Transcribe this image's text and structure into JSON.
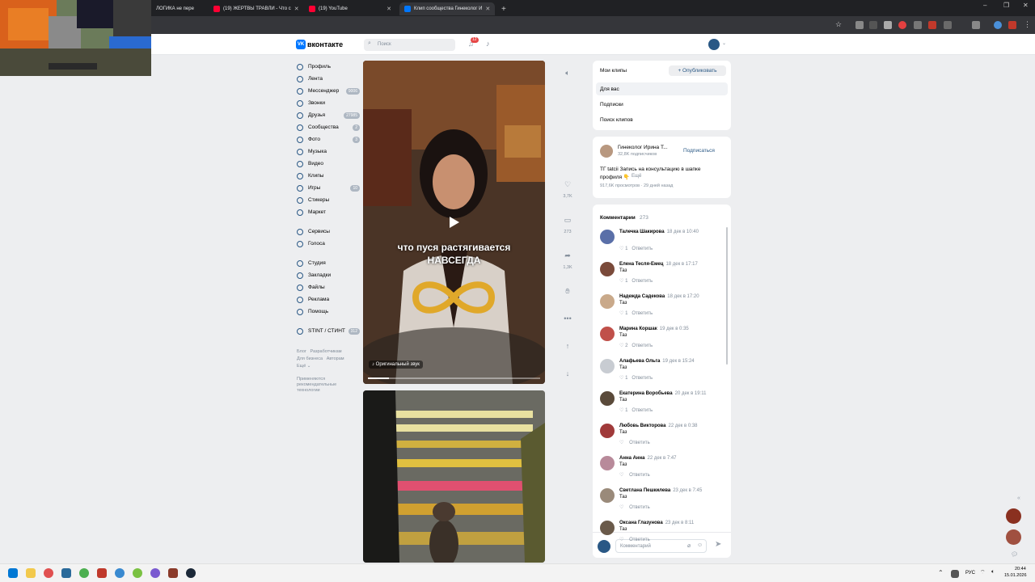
{
  "browser": {
    "tabs": [
      {
        "title": "ЛОГИКА не пере"
      },
      {
        "title": "(19) ЖЕРТВЫ ТРАВЛИ - Что с"
      },
      {
        "title": "(19) YouTube"
      },
      {
        "title": "Клип сообщества Гинеколог И"
      }
    ],
    "new_tab": "+",
    "window_controls": {
      "min": "–",
      "max": "❐",
      "close": "✕"
    }
  },
  "vk": {
    "logo_text": "вконтакте",
    "search_placeholder": "Поиск",
    "notif_count": "12"
  },
  "nav": {
    "items": [
      {
        "label": "Профиль",
        "badge": ""
      },
      {
        "label": "Лента",
        "badge": ""
      },
      {
        "label": "Мессенджер",
        "badge": "9006"
      },
      {
        "label": "Звонки",
        "badge": ""
      },
      {
        "label": "Друзья",
        "badge": "27985"
      },
      {
        "label": "Сообщества",
        "badge": "2"
      },
      {
        "label": "Фото",
        "badge": "3"
      },
      {
        "label": "Музыка",
        "badge": ""
      },
      {
        "label": "Видео",
        "badge": ""
      },
      {
        "label": "Клипы",
        "badge": ""
      },
      {
        "label": "Игры",
        "badge": "10"
      },
      {
        "label": "Стикеры",
        "badge": ""
      },
      {
        "label": "Маркет",
        "badge": ""
      }
    ],
    "items2": [
      {
        "label": "Сервисы",
        "badge": ""
      },
      {
        "label": "Голоса",
        "badge": ""
      }
    ],
    "items3": [
      {
        "label": "Студия",
        "badge": ""
      },
      {
        "label": "Закладки",
        "badge": ""
      },
      {
        "label": "Файлы",
        "badge": ""
      },
      {
        "label": "Реклама",
        "badge": ""
      },
      {
        "label": "Помощь",
        "badge": ""
      }
    ],
    "items4": [
      {
        "label": "STINT / СТИНТ",
        "badge": "312"
      }
    ],
    "footer": {
      "blog": "Блог",
      "devs": "Разработчикам",
      "business": "Для бизнеса",
      "authors": "Авторам",
      "more": "Ещё ⌄",
      "rec": "Применяются рекомендательные технологии"
    }
  },
  "video": {
    "caption_line1": "что пуся растягивается",
    "caption_line2": "НАВСЕГДА",
    "sound_label": "♪ Оригинальный звук",
    "progress": 0.12
  },
  "actions": {
    "likes": "3,7K",
    "comments": "273",
    "shares": "1,3K"
  },
  "clips_menu": {
    "title": "Мои клипы",
    "publish": "Опубликовать",
    "items": [
      "Для вас",
      "Подписки",
      "Поиск клипов"
    ]
  },
  "author": {
    "name": "Гинеколог Ирина Т...",
    "subs": "32,8K подписчиков",
    "subscribe": "Подписаться",
    "desc_line1": "TГ tatcii Запись на консультацию в шапке",
    "desc_line2": "профиля 👇",
    "more": "Ещё",
    "stats": "917,6K просмотров · 29 дней назад"
  },
  "comments": {
    "title": "Комментарии",
    "count": "273",
    "placeholder": "Комментарий",
    "list": [
      {
        "name": "Талечка Шакирова",
        "date": "18 дек в 10:40",
        "text": "",
        "likes": "1",
        "color": "#5a6fa8"
      },
      {
        "name": "Елена Тесля-Емец",
        "date": "18 дек в 17:17",
        "text": "Таз",
        "likes": "1",
        "color": "#7a4a3a"
      },
      {
        "name": "Надежда Садекова",
        "date": "18 дек в 17:20",
        "text": "Таз",
        "likes": "1",
        "color": "#c9a98a"
      },
      {
        "name": "Марина Коршак",
        "date": "19 дек в 0:35",
        "text": "Таз",
        "likes": "2",
        "color": "#c0504a"
      },
      {
        "name": "Алафьева Ольга",
        "date": "19 дек в 15:24",
        "text": "Таз",
        "likes": "1",
        "color": "#c8ccd2"
      },
      {
        "name": "Екатерина Воробьева",
        "date": "20 дек в 19:11",
        "text": "Таз",
        "likes": "1",
        "color": "#5a4a3a"
      },
      {
        "name": "Любовь Викторова",
        "date": "22 дек в 0:38",
        "text": "Таз",
        "likes": "",
        "color": "#a03a3a"
      },
      {
        "name": "Анна Анна",
        "date": "22 дек в 7:47",
        "text": "Таз",
        "likes": "",
        "color": "#b88a9a"
      },
      {
        "name": "Светлана Пешкилева",
        "date": "23 дек в 7:45",
        "text": "Таз",
        "likes": "",
        "color": "#9a8a7a"
      },
      {
        "name": "Оксана Глазунова",
        "date": "23 дек в 8:11",
        "text": "Таз",
        "likes": "",
        "color": "#6a5a4a"
      }
    ],
    "reply": "Ответить"
  },
  "taskbar": {
    "lang": "РУС",
    "time": "20:44",
    "date": "15.01.2026"
  }
}
